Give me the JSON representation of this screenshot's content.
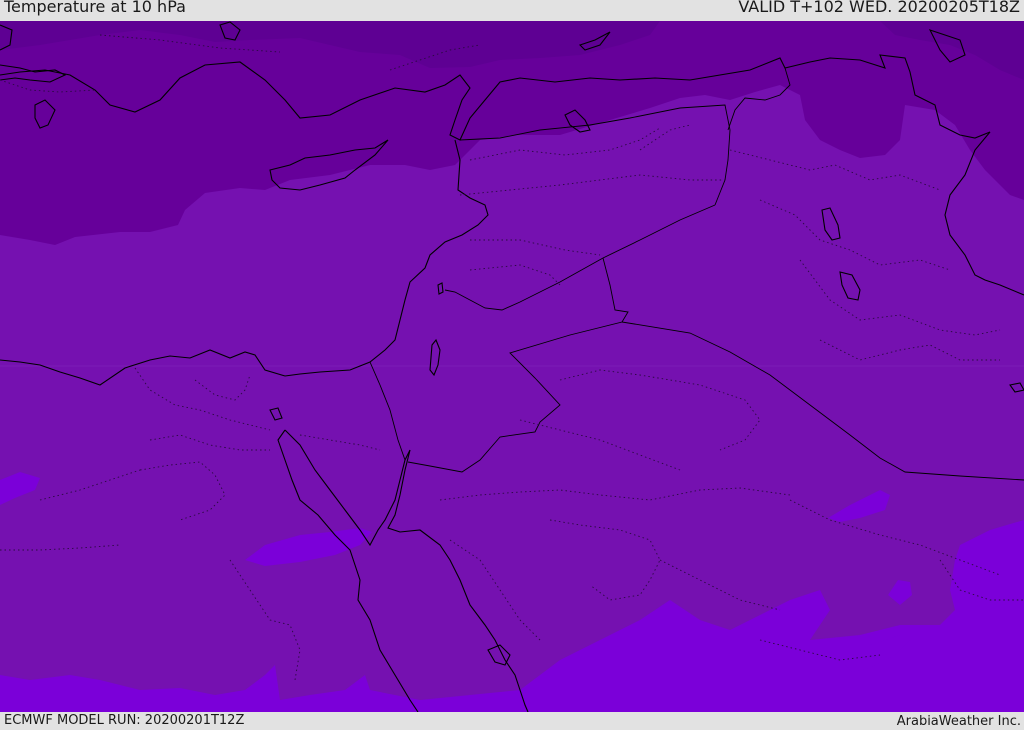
{
  "header": {
    "title": "Temperature at 10 hPa",
    "valid": "VALID T+102 WED. 20200205T18Z"
  },
  "footer": {
    "model_run": "ECMWF MODEL RUN: 20200201T12Z",
    "credit": "ArabiaWeather Inc."
  },
  "colors": {
    "coldest": "#5e0093",
    "cold": "#66009a",
    "mid": "#7511b0",
    "warm": "#7b00d9",
    "coast": "#000000",
    "border": "#000000",
    "admin_dotted": "#2a0a40"
  }
}
